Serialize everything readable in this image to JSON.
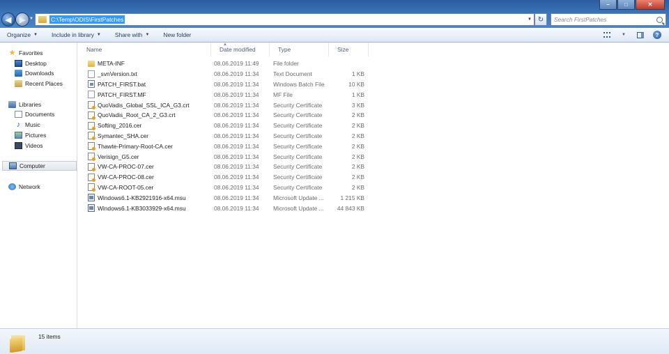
{
  "window": {
    "controls": {
      "minimize": "–",
      "maximize": "□",
      "close": "✕"
    }
  },
  "address": {
    "path": "C:\\Temp\\ODIS\\FirstPatches",
    "search_placeholder": "Search FirstPatches"
  },
  "toolbar": {
    "organize": "Organize",
    "include_in_library": "Include in library",
    "share_with": "Share with",
    "new_folder": "New folder"
  },
  "navpane": {
    "favorites": "Favorites",
    "desktop": "Desktop",
    "downloads": "Downloads",
    "recent_places": "Recent Places",
    "libraries": "Libraries",
    "documents": "Documents",
    "music": "Music",
    "pictures": "Pictures",
    "videos": "Videos",
    "computer": "Computer",
    "network": "Network"
  },
  "columns": {
    "name": "Name",
    "date": "Date modified",
    "type": "Type",
    "size": "Size"
  },
  "files": [
    {
      "name": "META-INF",
      "date": "08.06.2019 11:49",
      "type": "File folder",
      "size": "",
      "icon": "folder-icon"
    },
    {
      "name": "_svnVersion.txt",
      "date": "08.06.2019 11:34",
      "type": "Text Document",
      "size": "1 KB",
      "icon": "text-file-icon"
    },
    {
      "name": "PATCH_FIRST.bat",
      "date": "08.06.2019 11:34",
      "type": "Windows Batch File",
      "size": "10 KB",
      "icon": "batch-file-icon"
    },
    {
      "name": "PATCH_FIRST.MF",
      "date": "08.06.2019 11:34",
      "type": "MF File",
      "size": "1 KB",
      "icon": "generic-file-icon"
    },
    {
      "name": "QuoVadis_Global_SSL_ICA_G3.crt",
      "date": "08.06.2019 11:34",
      "type": "Security Certificate",
      "size": "3 KB",
      "icon": "certificate-icon"
    },
    {
      "name": "QuoVadis_Root_CA_2_G3.crt",
      "date": "08.06.2019 11:34",
      "type": "Security Certificate",
      "size": "2 KB",
      "icon": "certificate-icon"
    },
    {
      "name": "Softing_2016.cer",
      "date": "08.06.2019 11:34",
      "type": "Security Certificate",
      "size": "2 KB",
      "icon": "certificate-icon"
    },
    {
      "name": "Symantec_SHA.cer",
      "date": "08.06.2019 11:34",
      "type": "Security Certificate",
      "size": "2 KB",
      "icon": "certificate-icon"
    },
    {
      "name": "Thawte-Primary-Root-CA.cer",
      "date": "08.06.2019 11:34",
      "type": "Security Certificate",
      "size": "2 KB",
      "icon": "certificate-icon"
    },
    {
      "name": "Verisign_G5.cer",
      "date": "08.06.2019 11:34",
      "type": "Security Certificate",
      "size": "2 KB",
      "icon": "certificate-icon"
    },
    {
      "name": "VW-CA-PROC-07.cer",
      "date": "08.06.2019 11:34",
      "type": "Security Certificate",
      "size": "2 KB",
      "icon": "certificate-icon"
    },
    {
      "name": "VW-CA-PROC-08.cer",
      "date": "08.06.2019 11:34",
      "type": "Security Certificate",
      "size": "2 KB",
      "icon": "certificate-icon"
    },
    {
      "name": "VW-CA-ROOT-05.cer",
      "date": "08.06.2019 11:34",
      "type": "Security Certificate",
      "size": "2 KB",
      "icon": "certificate-icon"
    },
    {
      "name": "Windows6.1-KB2921916-x64.msu",
      "date": "08.06.2019 11:34",
      "type": "Microsoft Update ...",
      "size": "1 215 KB",
      "icon": "msu-file-icon"
    },
    {
      "name": "Windows6.1-KB3033929-x64.msu",
      "date": "08.06.2019 11:34",
      "type": "Microsoft Update ...",
      "size": "44 843 KB",
      "icon": "msu-file-icon"
    }
  ],
  "status": {
    "item_count": "15 items"
  }
}
